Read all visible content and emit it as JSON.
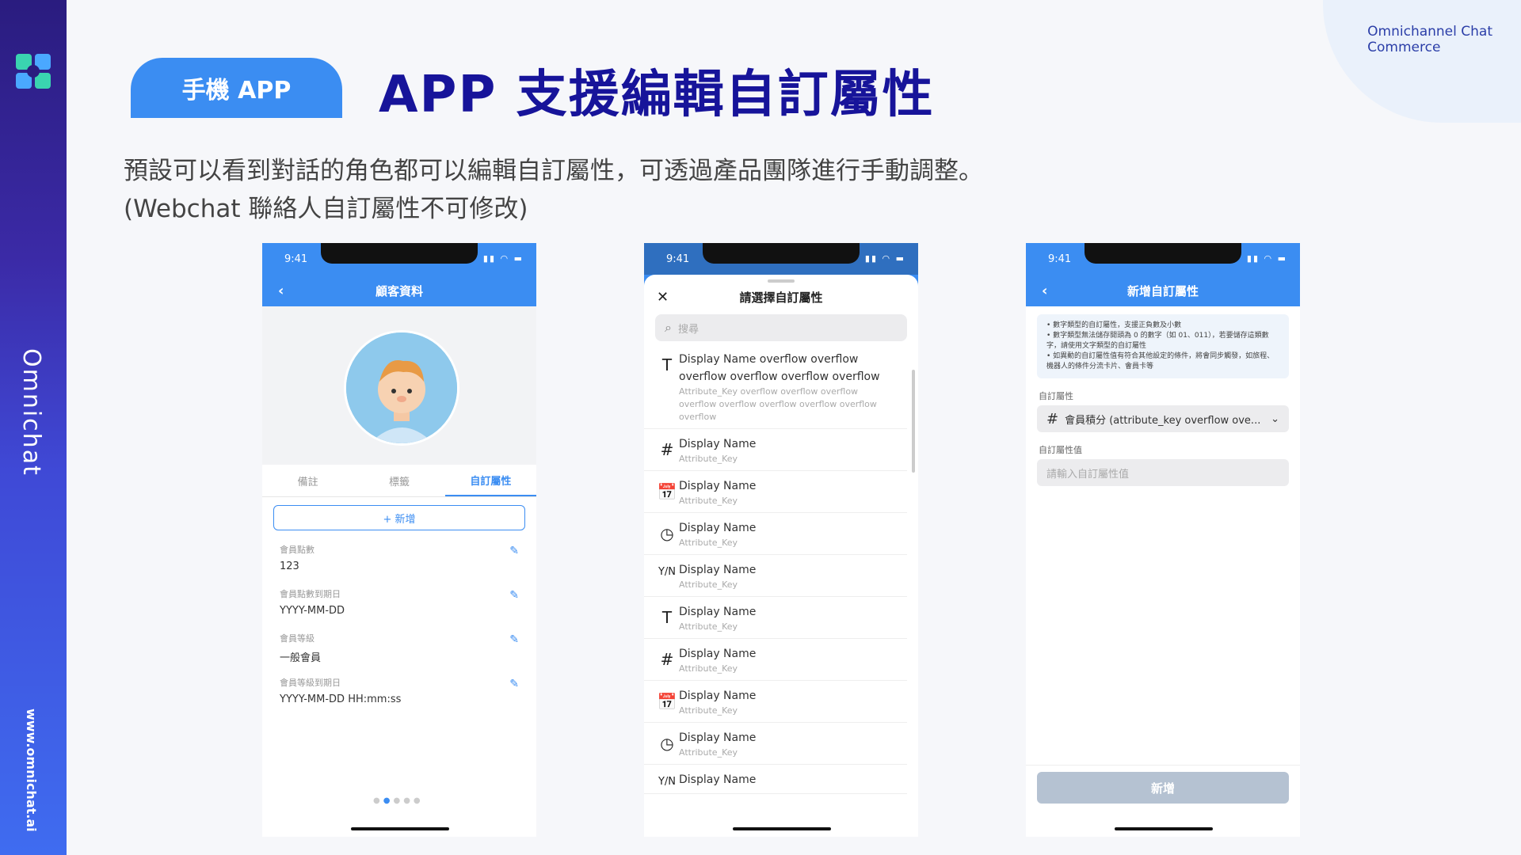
{
  "sidebar": {
    "vertical_text": "Omnichat",
    "url": "www.omnichat.ai"
  },
  "brand": {
    "line1": "Omnichannel Chat",
    "line2": "Commerce"
  },
  "header": {
    "pill_label": "手機 APP",
    "title": "APP 支援編輯自訂屬性"
  },
  "description": {
    "line1": "預設可以看到對話的角色都可以編輯自訂屬性，可透過產品團隊進行手動調整。",
    "line2": "(Webchat 聯絡人自訂屬性不可修改)"
  },
  "phones": {
    "status_time": "9:41",
    "p1": {
      "title": "顧客資料",
      "tabs": [
        "備註",
        "標籤",
        "自訂屬性"
      ],
      "add_label": "+ 新增",
      "fields": [
        {
          "label": "會員點數",
          "value": "123"
        },
        {
          "label": "會員點數到期日",
          "value": "YYYY-MM-DD"
        },
        {
          "label": "會員等級",
          "value": "一般會員"
        },
        {
          "label": "會員等級到期日",
          "value": "YYYY-MM-DD HH:mm:ss"
        }
      ]
    },
    "p2": {
      "title": "請選擇自訂屬性",
      "search_placeholder": "搜尋",
      "items": [
        {
          "icon": "T",
          "name": "Display Name overflow overflow overflow overflow overflow overflow",
          "key": "Attribute_Key overflow overflow overflow overflow overflow overflow overflow overflow overflow"
        },
        {
          "icon": "#",
          "name": "Display Name",
          "key": "Attribute_Key"
        },
        {
          "icon": "📅",
          "name": "Display Name",
          "key": "Attribute_Key"
        },
        {
          "icon": "◷",
          "name": "Display Name",
          "key": "Attribute_Key"
        },
        {
          "icon": "Y/N",
          "name": "Display Name",
          "key": "Attribute_Key"
        },
        {
          "icon": "T",
          "name": "Display Name",
          "key": "Attribute_Key"
        },
        {
          "icon": "#",
          "name": "Display Name",
          "key": "Attribute_Key"
        },
        {
          "icon": "📅",
          "name": "Display Name",
          "key": "Attribute_Key"
        },
        {
          "icon": "◷",
          "name": "Display Name",
          "key": "Attribute_Key"
        },
        {
          "icon": "Y/N",
          "name": "Display Name",
          "key": ""
        }
      ]
    },
    "p3": {
      "title": "新增自訂屬性",
      "info": [
        "• 數字類型的自訂屬性，支援正負數及小數",
        "• 數字類型無法儲存開頭為 0 的數字（如 01、011），若要儲存這類數字，請使用文字類型的自訂屬性",
        "• 如異動的自訂屬性值有符合其他設定的條件，將會同步觸發，如旅程、機器人的條件分流卡片、會員卡等"
      ],
      "attr_label": "自訂屬性",
      "attr_value": "會員積分 (attribute_key overflow ove...",
      "value_label": "自訂屬性值",
      "value_placeholder": "請輸入自訂屬性值",
      "submit_label": "新增"
    }
  }
}
